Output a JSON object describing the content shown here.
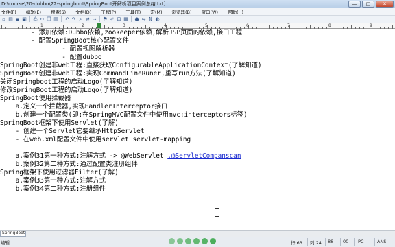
{
  "window": {
    "title": "D:\\course\\20-dubbo\\22-springboot\\SpringBoot开解析项目案例总结.txt]",
    "min_label": "—",
    "max_label": "□",
    "close_label": "✕"
  },
  "menu": [
    "文件(F)",
    "编辑(E)",
    "搜索(S)",
    "文档(D)",
    "工程(P)",
    "工具(T)",
    "宏(M)",
    "浏览器(B)",
    "窗口(W)",
    "帮助(H)"
  ],
  "toolbar_icons": [
    "new-icon",
    "open-icon",
    "save-icon",
    "save-all-icon",
    "print-icon",
    "cut-icon",
    "copy-icon",
    "paste-icon",
    "undo-icon",
    "redo-icon",
    "find-icon",
    "replace-icon",
    "goto-icon",
    "bookmark-icon",
    "wrap-icon",
    "hex-icon",
    "column-icon",
    "macro-icon",
    "compare-icon",
    "ftp-icon",
    "browser-icon"
  ],
  "ruler": {
    "numbers": [
      "0",
      "1",
      "2",
      "3",
      "4",
      "5",
      "6",
      "7",
      "8",
      "9"
    ],
    "caret_color": "#2f8a3a"
  },
  "editor": {
    "lines": [
      "        - 添加依赖:Dubbo依赖,zookeeper依赖,解析JSP页面的依赖,接口工程",
      "        - 配置SpringBoot核心配置文件",
      "                - 配置视图解析器",
      "                - 配置dubbo",
      "SpringBoot创建非web工程:直接获取ConfigurableApplicationContext(了解知道)",
      "SpringBoot创建非web工程:实现CommandLineRuner,重写run方法(了解知道)",
      "关闭Springboot工程的启动Logo(了解知道)",
      "修改SpringBoot工程的启动Logo(了解知道)",
      "SpringBoot使用拦截器",
      "    a.定义一个拦截器,实现HandlerInterceptor接口",
      "    b.创建一个配置类(即:在SpringMVC配置文件中使用mvc:interceptors标签)",
      "SpringBoot框架下使用Servlet(了解)",
      "    - 创建一个Servlet它要继承HttpServlet",
      "    - 在web.xml配置文件中使用servlet servlet-mapping",
      "",
      "    a.案例31第一种方式:注解方式 -> @WebServlet ",
      "    b.案例32第二种方式:通过配置类注册组件",
      "Spring框架下使用过滤器Filter(了解)",
      "    a.案例33第一种方式:注解方式",
      "    b.案例34第二种方式:注册组件"
    ],
    "link_text": ",@ServletCompanscan",
    "link_color": "#1a2bd0"
  },
  "doc_tab": {
    "label": "SpringBoot开解析项目"
  },
  "status": {
    "left": "编辑",
    "line": "行 63",
    "col": "列 24",
    "chars": "88",
    "pos": "00",
    "mode": "PC",
    "encoding": "ANSI"
  },
  "status_icon_colors": [
    "#3aa74a",
    "#3aa74a",
    "#3aa74a",
    "#3aa74a",
    "#3aa74a",
    "#3aa74a"
  ]
}
